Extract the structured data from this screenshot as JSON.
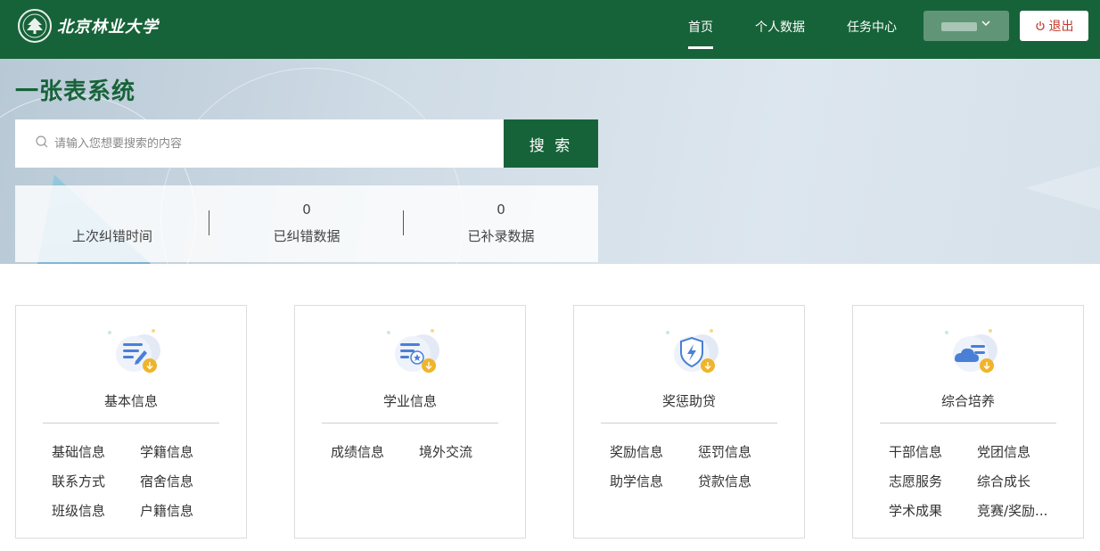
{
  "header": {
    "logo_text": "北京林业大学",
    "nav": [
      {
        "label": "首页",
        "active": true
      },
      {
        "label": "个人数据",
        "active": false
      },
      {
        "label": "任务中心",
        "active": false
      }
    ],
    "logout_label": "退出"
  },
  "hero": {
    "title": "一张表系统",
    "search": {
      "placeholder": "请输入您想要搜索的内容",
      "value": "",
      "button_label": "搜 索"
    },
    "stats": [
      {
        "value": "",
        "label": "上次纠错时间"
      },
      {
        "value": "0",
        "label": "已纠错数据"
      },
      {
        "value": "0",
        "label": "已补录数据"
      }
    ]
  },
  "cards": [
    {
      "title": "基本信息",
      "icon": "edit-document-icon",
      "links": [
        "基础信息",
        "学籍信息",
        "联系方式",
        "宿舍信息",
        "班级信息",
        "户籍信息"
      ]
    },
    {
      "title": "学业信息",
      "icon": "academic-badge-icon",
      "links": [
        "成绩信息",
        "境外交流"
      ]
    },
    {
      "title": "奖惩助贷",
      "icon": "shield-lightning-icon",
      "links": [
        "奖励信息",
        "惩罚信息",
        "助学信息",
        "贷款信息"
      ]
    },
    {
      "title": "综合培养",
      "icon": "cloud-list-icon",
      "links": [
        "干部信息",
        "党团信息",
        "志愿服务",
        "综合成长",
        "学术成果",
        "竞赛/奖励..."
      ]
    }
  ],
  "colors": {
    "primary": "#176339",
    "danger": "#c0392b",
    "icon_accent": "#f0b429",
    "icon_blue": "#4a7fd6"
  }
}
